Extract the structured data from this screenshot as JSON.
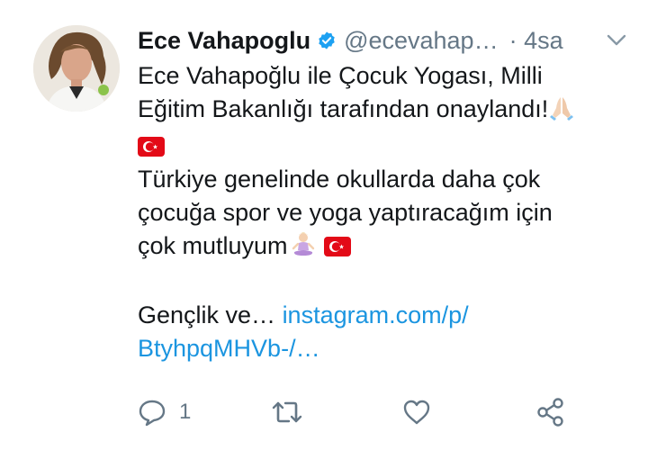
{
  "author": {
    "name": "Ece Vahapoglu",
    "handle": "@ecevahap…",
    "time": "· 4sa",
    "verified": true
  },
  "tweet": {
    "line1": "Ece Vahapoğlu ile Çocuk Yogası, Milli",
    "line2": "Eğitim Bakanlığı tarafından onaylandı!",
    "line4": "Türkiye genelinde okullarda daha çok",
    "line5": "çocuğa spor ve yoga yaptıracağım için",
    "line6": "çok mutluyum",
    "line8_text": "Gençlik ve… ",
    "line8_link": "instagram.com/p/",
    "line9_link": "BtyhpqMHVb-/…"
  },
  "actions": {
    "reply_count": "1"
  },
  "icons": {
    "reply": "reply-icon",
    "retweet": "retweet-icon",
    "like": "heart-icon",
    "share": "share-icon",
    "verified": "verified-badge-icon",
    "menu": "chevron-down-icon"
  },
  "colors": {
    "text": "#14171a",
    "secondary": "#657786",
    "link": "#1b95e0",
    "verified": "#1da1f2",
    "flag_red": "#e30a17"
  }
}
